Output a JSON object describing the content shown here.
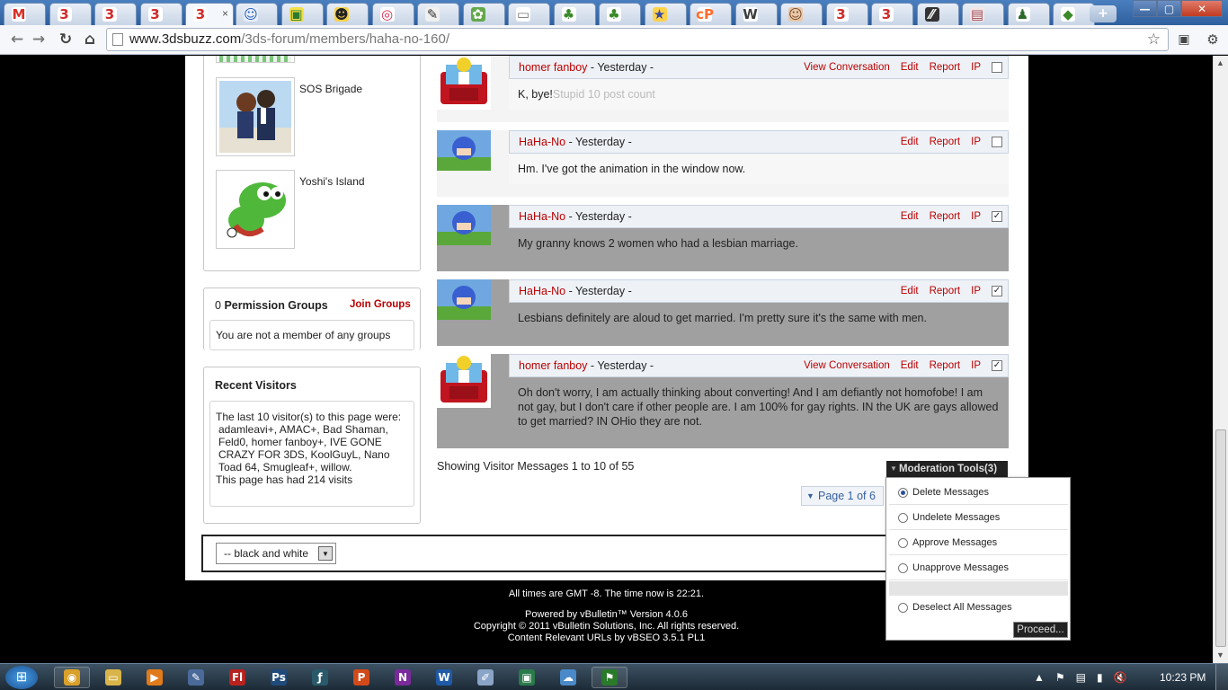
{
  "browser": {
    "tabs": [
      {
        "name": "gmail",
        "glyph": "M",
        "color": "#d93025",
        "bg": "#ffffff"
      },
      {
        "name": "3dsbuzz",
        "glyph": "3",
        "color": "#d12b2b",
        "bg": "#ffffff"
      },
      {
        "name": "3dsbuzz",
        "glyph": "3",
        "color": "#d12b2b",
        "bg": "#ffffff"
      },
      {
        "name": "3dsbuzz",
        "glyph": "3",
        "color": "#d12b2b",
        "bg": "#ffffff"
      },
      {
        "name": "3dsbuzz-active",
        "glyph": "3",
        "color": "#d12b2b",
        "bg": "#ffffff"
      },
      {
        "name": "user",
        "glyph": "☺",
        "color": "#1e5cb3",
        "bg": "#e8eef9"
      },
      {
        "name": "game",
        "glyph": "▣",
        "color": "#2c7a2c",
        "bg": "#f2e04b"
      },
      {
        "name": "chat",
        "glyph": "☻",
        "color": "#222222",
        "bg": "#f7d24a"
      },
      {
        "name": "circle",
        "glyph": "◎",
        "color": "#d62a4c",
        "bg": "#ffffff"
      },
      {
        "name": "sketch",
        "glyph": "✎",
        "color": "#333333",
        "bg": "#f0f0f0"
      },
      {
        "name": "green",
        "glyph": "✿",
        "color": "#ffffff",
        "bg": "#64a84a"
      },
      {
        "name": "page",
        "glyph": "▭",
        "color": "#777777",
        "bg": "#ffffff"
      },
      {
        "name": "clover",
        "glyph": "♣",
        "color": "#3a8a2a",
        "bg": "#ffffff"
      },
      {
        "name": "clover",
        "glyph": "♣",
        "color": "#3a8a2a",
        "bg": "#ffffff"
      },
      {
        "name": "star",
        "glyph": "★",
        "color": "#3a4aa0",
        "bg": "#ffd24a"
      },
      {
        "name": "cpanel",
        "glyph": "cP",
        "color": "#ff6c2c",
        "bg": "#ffffff"
      },
      {
        "name": "wordpress",
        "glyph": "W",
        "color": "#3c3c3c",
        "bg": "#ffffff"
      },
      {
        "name": "face",
        "glyph": "☺",
        "color": "#7a4a2a",
        "bg": "#e8c8a8"
      },
      {
        "name": "3dsbuzz",
        "glyph": "3",
        "color": "#d12b2b",
        "bg": "#ffffff"
      },
      {
        "name": "3dsbuzz",
        "glyph": "3",
        "color": "#d12b2b",
        "bg": "#ffffff"
      },
      {
        "name": "dark",
        "glyph": "⁄⁄",
        "color": "#ffffff",
        "bg": "#333333"
      },
      {
        "name": "paper",
        "glyph": "▤",
        "color": "#a04a5a",
        "bg": "#f2e6e6"
      },
      {
        "name": "people",
        "glyph": "♟",
        "color": "#2a6a2a",
        "bg": "#ffffff"
      },
      {
        "name": "cube",
        "glyph": "◆",
        "color": "#3a8a2a",
        "bg": "#ffffff"
      }
    ],
    "close_glyph": "×",
    "new_tab_glyph": "+",
    "window": {
      "minimize": "—",
      "maximize": "▢",
      "close": "✕"
    },
    "nav": {
      "back": "←",
      "forward": "→",
      "reload": "↻",
      "home": "⌂",
      "star": "☆"
    },
    "url_host": "www.3dsbuzz.com",
    "url_path": "/3ds-forum/members/haha-no-160/"
  },
  "sidebar": {
    "groups": [
      {
        "name": "SOS Brigade"
      },
      {
        "name": "Yoshi's Island"
      }
    ],
    "permission": {
      "count": "0",
      "title": "Permission Groups",
      "join": "Join Groups",
      "text": "You are not a member of any groups"
    },
    "visitors": {
      "title": "Recent Visitors",
      "text": "The last 10 visitor(s) to this page were:",
      "list": "adamleavi+,  AMAC+,  Bad Shaman,  Feld0,  homer fanboy+,  IVE GONE CRAZY FOR 3DS,  KoolGuyL,  Nano Toad 64,  Smugleaf+,  willow.",
      "visits": "This page has had 214 visits"
    }
  },
  "messages": [
    {
      "author": "homer fanboy",
      "when": " - Yesterday -",
      "view": "View Conversation",
      "text": "K, bye!",
      "note": "Stupid 10 post count",
      "checked": false
    },
    {
      "author": "HaHa-No",
      "when": " - Yesterday -",
      "view": "",
      "text": "Hm. I've got the animation in the window now.",
      "note": "",
      "checked": false
    },
    {
      "author": "HaHa-No",
      "when": " - Yesterday -",
      "view": "",
      "text": "My granny knows 2 women who had a lesbian marriage.",
      "note": "",
      "checked": true
    },
    {
      "author": "HaHa-No",
      "when": " - Yesterday -",
      "view": "",
      "text": "Lesbians definitely are aloud to get married. I'm pretty sure it's the same with men.",
      "note": "",
      "checked": true
    },
    {
      "author": "homer fanboy",
      "when": " - Yesterday -",
      "view": "View Conversation",
      "text": "Oh don't worry, I am actually thinking about converting! And I am defiantly not homofobe! I am not gay, but I don't care if other people are. I am 100% for gay rights. IN the UK are gays allowed to get married? IN OHio they are not.",
      "note": "",
      "checked": true
    }
  ],
  "actions": {
    "edit": "Edit",
    "report": "Report",
    "ip": "IP",
    "check": "✓"
  },
  "showing": "Showing Visitor Messages 1 to 10 of 55",
  "pagination": "Page 1 of 6",
  "moderation": {
    "button": "Moderation Tools(3)",
    "options": [
      {
        "label": "Delete Messages",
        "selected": true
      },
      {
        "label": "Undelete Messages",
        "selected": false
      },
      {
        "label": "Approve Messages",
        "selected": false
      },
      {
        "label": "Unapprove Messages",
        "selected": false
      },
      {
        "label": "Deselect All Messages",
        "selected": false
      }
    ],
    "proceed": "Proceed..."
  },
  "style_chooser": "-- black and white",
  "footer": {
    "time": "All times are GMT -8. The time now is 22:21.",
    "powered": "Powered by vBulletin™ Version 4.0.6",
    "copyright": "Copyright © 2011 vBulletin Solutions, Inc. All rights reserved.",
    "seo": "Content Relevant URLs by vBSEO 3.5.1 PL1"
  },
  "taskbar": {
    "start": "⊞",
    "apps": [
      {
        "name": "chrome",
        "glyph": "◉",
        "bg": "#d9a02a",
        "open": true
      },
      {
        "name": "explorer",
        "glyph": "▭",
        "bg": "#d8b44a",
        "open": false
      },
      {
        "name": "media-player",
        "glyph": "▶",
        "bg": "#e07a1a",
        "open": false
      },
      {
        "name": "paint",
        "glyph": "✎",
        "bg": "#4a6a9a",
        "open": false
      },
      {
        "name": "flash",
        "glyph": "Fl",
        "bg": "#b8221e",
        "open": false
      },
      {
        "name": "photoshop",
        "glyph": "Ps",
        "bg": "#1f4a7a",
        "open": false
      },
      {
        "name": "script",
        "glyph": "ƒ",
        "bg": "#2a5a6a",
        "open": false
      },
      {
        "name": "powerpoint",
        "glyph": "P",
        "bg": "#d24a1a",
        "open": false
      },
      {
        "name": "onenote",
        "glyph": "N",
        "bg": "#7a2a9a",
        "open": false
      },
      {
        "name": "word",
        "glyph": "W",
        "bg": "#1f5aa8",
        "open": false
      },
      {
        "name": "notepad",
        "glyph": "✐",
        "bg": "#8aa4c8",
        "open": false
      },
      {
        "name": "remote",
        "glyph": "▣",
        "bg": "#2a7a4a",
        "open": false
      },
      {
        "name": "weather",
        "glyph": "☁",
        "bg": "#4a8ac8",
        "open": false
      },
      {
        "name": "flag",
        "glyph": "⚑",
        "bg": "#2a7a2a",
        "open": true
      }
    ],
    "tray": [
      "▲",
      "⚑",
      "▤",
      "▮",
      "🔇"
    ],
    "clock": "10:23 PM"
  }
}
